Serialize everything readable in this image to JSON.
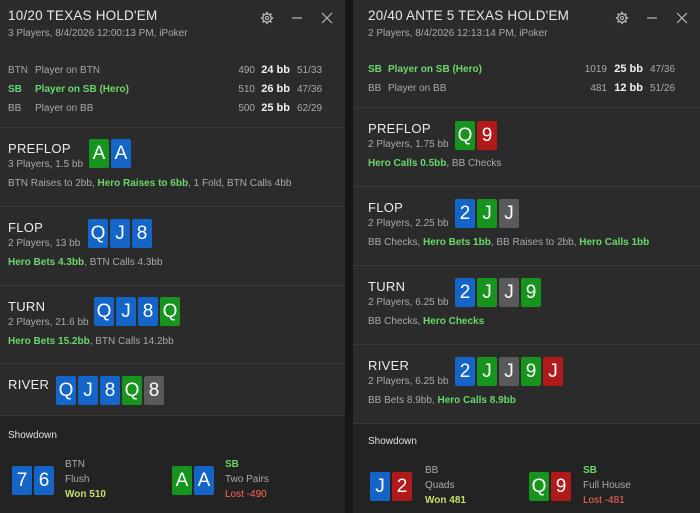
{
  "left": {
    "title": "10/20 TEXAS HOLD'EM",
    "subtitle": "3 Players, 8/4/2026 12:00:13 PM, iPoker",
    "players": [
      {
        "pos": "BTN",
        "name": "Player on BTN",
        "stack": "490",
        "bb": "24 bb",
        "vpip": "51/33"
      },
      {
        "pos": "SB",
        "name": "Player on SB (Hero)",
        "stack": "510",
        "bb": "26 bb",
        "vpip": "47/36"
      },
      {
        "pos": "BB",
        "name": "Player on BB",
        "stack": "500",
        "bb": "25 bb",
        "vpip": "62/29"
      }
    ],
    "preflop": {
      "street": "PREFLOP",
      "info": "3 Players, 1.5 bb",
      "a1": "BTN Raises to 2bb, ",
      "a2": "Hero Raises to 6bb",
      "a3": ", 1 Fold, BTN Calls 4bb"
    },
    "flop": {
      "street": "FLOP",
      "info": "2 Players, 13 bb",
      "a1": "Hero Bets 4.3bb",
      "a2": ", BTN Calls 4.3bb"
    },
    "turn": {
      "street": "TURN",
      "info": "2 Players, 21.6 bb",
      "a1": "Hero Bets 15.2bb",
      "a2": ", BTN Calls 14.2bb"
    },
    "river": {
      "street": "RIVER"
    },
    "showdown": {
      "title": "Showdown",
      "p1": {
        "pos": "BTN",
        "hand": "Flush",
        "result": "Won 510"
      },
      "p2": {
        "pos": "SB",
        "hand": "Two Pairs",
        "result": "Lost -490"
      }
    },
    "cards": {
      "preflop": [
        "A",
        "A"
      ],
      "flop": [
        "Q",
        "J",
        "8"
      ],
      "turn": [
        "Q",
        "J",
        "8",
        "Q"
      ],
      "river": [
        "Q",
        "J",
        "8",
        "Q",
        "8"
      ],
      "sd1": [
        "7",
        "6"
      ],
      "sd2": [
        "A",
        "A"
      ]
    }
  },
  "right": {
    "title": "20/40 ANTE 5 TEXAS HOLD'EM",
    "subtitle": "2 Players, 8/4/2026 12:13:14 PM, iPoker",
    "players": [
      {
        "pos": "SB",
        "name": "Player on SB (Hero)",
        "stack": "1019",
        "bb": "25 bb",
        "vpip": "47/36"
      },
      {
        "pos": "BB",
        "name": "Player on BB",
        "stack": "481",
        "bb": "12 bb",
        "vpip": "51/26"
      }
    ],
    "preflop": {
      "street": "PREFLOP",
      "info": "2 Players, 1.75 bb",
      "a1": "Hero Calls 0.5bb",
      "a2": ", BB Checks"
    },
    "flop": {
      "street": "FLOP",
      "info": "2 Players, 2.25 bb",
      "a1": "BB Checks, ",
      "a2": "Hero Bets 1bb",
      "a3": ", BB Raises to 2bb, ",
      "a4": "Hero Calls 1bb"
    },
    "turn": {
      "street": "TURN",
      "info": "2 Players, 6.25 bb",
      "a1": "BB Checks, ",
      "a2": "Hero Checks"
    },
    "river": {
      "street": "RIVER",
      "info": "2 Players, 6.25 bb",
      "a1": "BB Bets 8.9bb, ",
      "a2": "Hero Calls 8.9bb"
    },
    "showdown": {
      "title": "Showdown",
      "p1": {
        "pos": "BB",
        "hand": "Quads",
        "result": "Won 481"
      },
      "p2": {
        "pos": "SB",
        "hand": "Full House",
        "result": "Lost -481"
      }
    },
    "cards": {
      "preflop": [
        "Q",
        "9"
      ],
      "flop": [
        "2",
        "J",
        "J"
      ],
      "turn": [
        "2",
        "J",
        "J",
        "9"
      ],
      "river": [
        "2",
        "J",
        "J",
        "9",
        "J"
      ],
      "sd1": [
        "J",
        "2"
      ],
      "sd2": [
        "Q",
        "9"
      ]
    }
  },
  "colors": {
    "blue": "#1565c8",
    "green": "#17941e",
    "red": "#b11a1a",
    "gray": "#5a5a5a",
    "hero": "#6ad86a",
    "won": "#c6e06a",
    "lost": "#ff6a5a"
  },
  "icons": [
    "gear-icon",
    "minimize-icon",
    "close-icon"
  ]
}
